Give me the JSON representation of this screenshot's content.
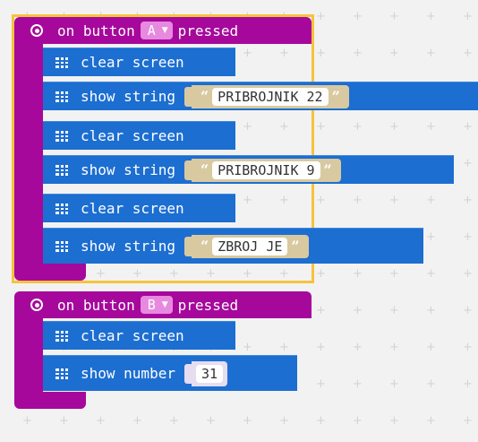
{
  "events": [
    {
      "prefix": "on button",
      "button_value": "A",
      "suffix": "pressed",
      "statements": [
        {
          "kind": "clear",
          "label": "clear screen"
        },
        {
          "kind": "string",
          "label": "show string",
          "value": "PRIBROJNIK 22"
        },
        {
          "kind": "clear",
          "label": "clear screen"
        },
        {
          "kind": "string",
          "label": "show string",
          "value": "PRIBROJNIK 9"
        },
        {
          "kind": "clear",
          "label": "clear screen"
        },
        {
          "kind": "string",
          "label": "show string",
          "value": "ZBROJ JE"
        }
      ]
    },
    {
      "prefix": "on button",
      "button_value": "B",
      "suffix": "pressed",
      "statements": [
        {
          "kind": "clear",
          "label": "clear screen"
        },
        {
          "kind": "number",
          "label": "show number",
          "value": "31"
        }
      ]
    }
  ],
  "quotes": {
    "open": "“",
    "close": "”"
  },
  "icons": {
    "event": "target-icon",
    "dropdown": "caret-down-icon",
    "block": "grid-icon"
  },
  "colors": {
    "event": "#a5089a",
    "statement": "#1d6ed1",
    "string": "#d9c9a0",
    "number": "#e7ddf0",
    "selection": "#f7c33a"
  }
}
